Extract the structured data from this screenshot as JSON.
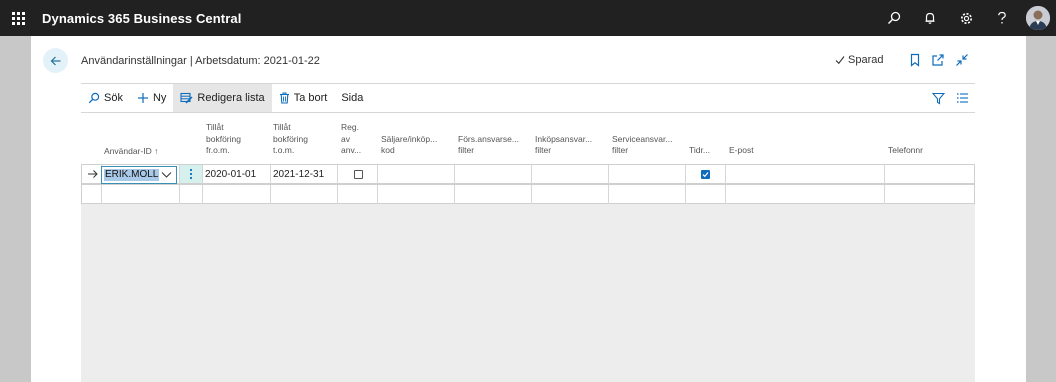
{
  "app": {
    "title": "Dynamics 365 Business Central"
  },
  "topbar_icons": [
    "waffle-icon",
    "search-icon",
    "bell-icon",
    "gear-icon",
    "help-icon",
    "avatar"
  ],
  "page": {
    "title": "Användarinställningar | Arbetsdatum: 2021-01-22",
    "saved_label": "Sparad"
  },
  "actions": {
    "search": "Sök",
    "new": "Ny",
    "edit_list": "Redigera lista",
    "delete": "Ta bort",
    "page": "Sida"
  },
  "columns": {
    "user_id": "Användar-ID",
    "allow_from": [
      "Tillåt",
      "bokföring",
      "fr.o.m."
    ],
    "allow_to": [
      "Tillåt",
      "bokföring",
      "t.o.m."
    ],
    "register_time": [
      "Reg.",
      "av",
      "anv..."
    ],
    "salesperson": [
      "Säljare/inköp...",
      "kod"
    ],
    "sales_resp": [
      "Förs.ansvarse...",
      "filter"
    ],
    "purch_resp": [
      "Inköpsansvar...",
      "filter"
    ],
    "service_resp": [
      "Serviceansvar...",
      "filter"
    ],
    "time_sheet": "Tidr...",
    "email": "E-post",
    "phone": "Telefonnr"
  },
  "rows": [
    {
      "user_id": "ERIK.MOLL",
      "allow_from": "2020-01-01",
      "allow_to": "2021-12-31",
      "register_time": false,
      "salesperson": "",
      "sales_resp": "",
      "purch_resp": "",
      "service_resp": "",
      "time_sheet": true,
      "email": "",
      "phone": ""
    }
  ],
  "colors": {
    "topbar": "#212121",
    "accent": "#0f6cbd",
    "selection": "#a8c9e8",
    "active_action": "#e6e6e6",
    "grid_empty": "#ededed"
  }
}
